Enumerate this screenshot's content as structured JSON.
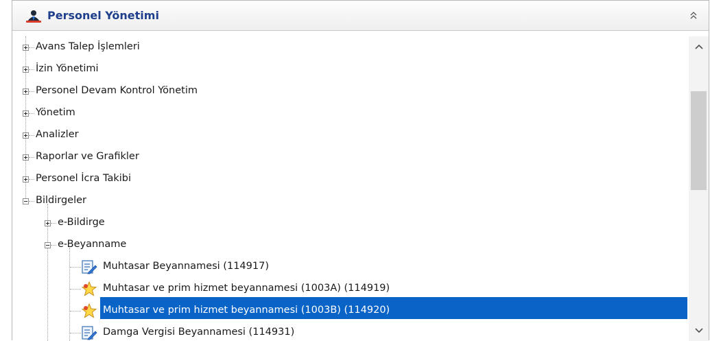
{
  "panel": {
    "title": "Personel Yönetimi",
    "title_color": "#1f3f8c",
    "icon": "person-icon",
    "collapse_icon": "double-chevron-up-icon"
  },
  "tree": {
    "items": [
      {
        "label": "Avans Talep İşlemleri",
        "state": "collapsed"
      },
      {
        "label": "İzin Yönetimi",
        "state": "collapsed"
      },
      {
        "label": "Personel Devam Kontrol Yönetim",
        "state": "collapsed"
      },
      {
        "label": "Yönetim",
        "state": "collapsed"
      },
      {
        "label": "Analizler",
        "state": "collapsed"
      },
      {
        "label": "Raporlar ve Grafikler",
        "state": "collapsed"
      },
      {
        "label": "Personel İcra Takibi",
        "state": "collapsed"
      },
      {
        "label": "Bildirgeler",
        "state": "expanded",
        "children": [
          {
            "label": "e-Bildirge",
            "state": "collapsed"
          },
          {
            "label": "e-Beyanname",
            "state": "expanded",
            "children": [
              {
                "label": "Muhtasar Beyannamesi (114917)",
                "icon": "document-edit-icon"
              },
              {
                "label": "Muhtasar ve prim hizmet beyannamesi (1003A) (114919)",
                "icon": "star-icon"
              },
              {
                "label": "Muhtasar ve prim hizmet beyannamesi (1003B) (114920)",
                "icon": "star-icon",
                "selected": true
              },
              {
                "label": "Damga Vergisi Beyannamesi (114931)",
                "icon": "document-edit-icon"
              }
            ]
          }
        ]
      }
    ]
  },
  "colors": {
    "selection": "#0a64c8",
    "scroll_thumb": "#cdcdcd"
  }
}
